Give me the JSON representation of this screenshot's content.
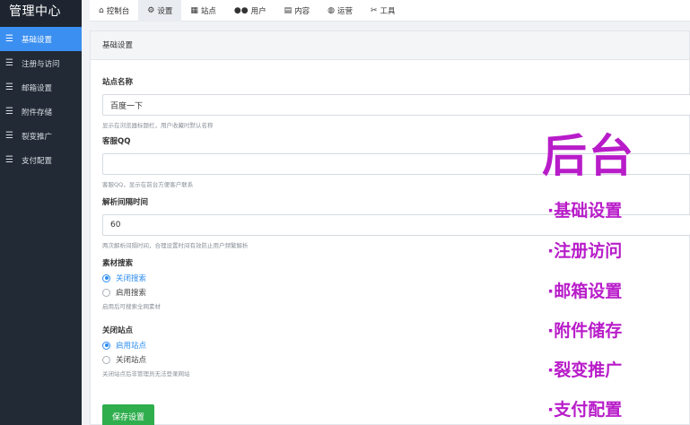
{
  "sidebar": {
    "brand": "管理中心",
    "items": [
      {
        "label": "基础设置",
        "active": true
      },
      {
        "label": "注册与访问",
        "active": false
      },
      {
        "label": "邮箱设置",
        "active": false
      },
      {
        "label": "附件存储",
        "active": false
      },
      {
        "label": "裂变推广",
        "active": false
      },
      {
        "label": "支付配置",
        "active": false
      }
    ]
  },
  "topbar": {
    "tabs": [
      {
        "label": "控制台",
        "icon": "home-icon"
      },
      {
        "label": "设置",
        "icon": "gear-icon"
      },
      {
        "label": "站点",
        "icon": "sitemap-icon"
      },
      {
        "label": "用户",
        "icon": "users-icon"
      },
      {
        "label": "内容",
        "icon": "document-icon"
      },
      {
        "label": "运营",
        "icon": "globe-icon"
      },
      {
        "label": "工具",
        "icon": "tools-icon"
      }
    ]
  },
  "panel": {
    "title": "基础设置",
    "site_name": {
      "label": "站点名称",
      "value": "百度一下",
      "help": "显示在浏览器标题栏，用户收藏时默认名称"
    },
    "qq": {
      "label": "客服QQ",
      "value": "",
      "help": "客服QQ，显示在前台方便客户联系"
    },
    "interval": {
      "label": "解析间隔时间",
      "value": "60",
      "help": "两次解析间隔时间，合理设置时间有效防止用户频繁解析"
    },
    "search": {
      "label": "素材搜索",
      "options": [
        "关闭搜索",
        "启用搜索"
      ],
      "selected": 0,
      "help": "启用后可搜索全网素材"
    },
    "close_site": {
      "label": "关闭站点",
      "options": [
        "启用站点",
        "关闭站点"
      ],
      "selected": 0,
      "help": "关闭站点后非管理员无法登录网站"
    },
    "save_label": "保存设置"
  },
  "overlay": {
    "title": "后台",
    "items": [
      "·基础设置",
      "·注册访问",
      "·邮箱设置",
      "·附件储存",
      "·裂变推广",
      "·支付配置"
    ],
    "color": "#b81cc9"
  }
}
